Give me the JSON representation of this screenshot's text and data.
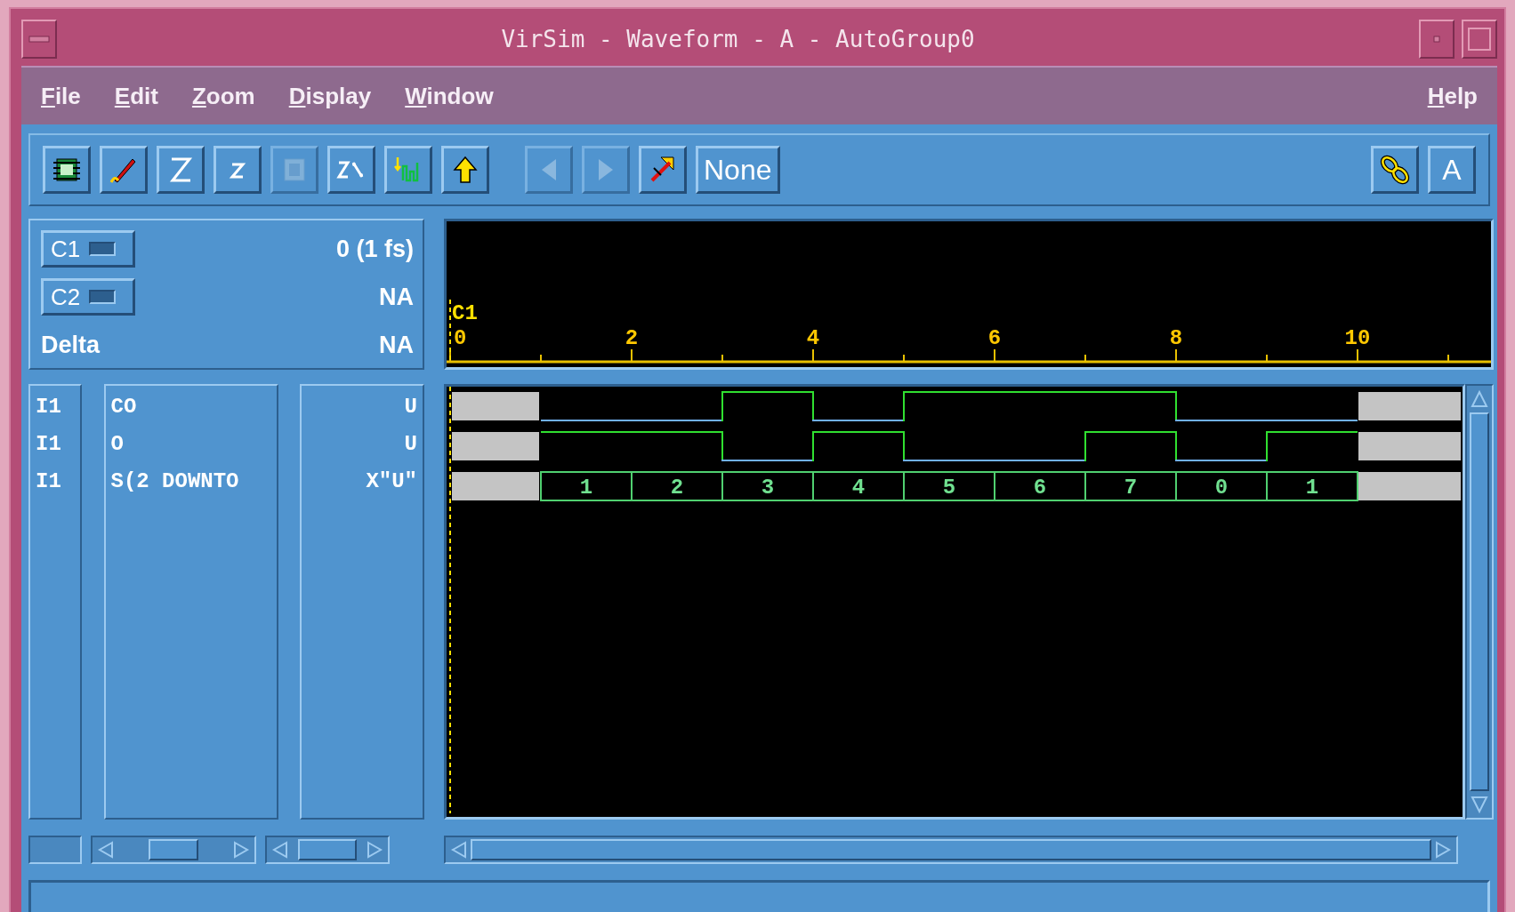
{
  "window": {
    "title": "VirSim - Waveform - A - AutoGroup0"
  },
  "menu": {
    "left": [
      {
        "label": "File"
      },
      {
        "label": "Edit"
      },
      {
        "label": "Zoom"
      },
      {
        "label": "Display"
      },
      {
        "label": "Window"
      }
    ],
    "right": [
      {
        "label": "Help"
      }
    ]
  },
  "toolbar": {
    "buttons": [
      {
        "kind": "icon",
        "disabled": false
      },
      {
        "kind": "icon",
        "disabled": false
      },
      {
        "kind": "icon",
        "disabled": false
      },
      {
        "kind": "icon",
        "disabled": false
      },
      {
        "kind": "icon",
        "disabled": true
      },
      {
        "kind": "icon",
        "disabled": false
      },
      {
        "kind": "icon",
        "disabled": false
      },
      {
        "kind": "icon",
        "disabled": false
      },
      {
        "kind": "icon",
        "disabled": true
      },
      {
        "kind": "icon",
        "disabled": true
      },
      {
        "kind": "icon",
        "disabled": false
      },
      {
        "kind": "text",
        "label": "None",
        "disabled": false
      }
    ],
    "right_buttons": [
      {
        "kind": "icon",
        "disabled": false
      },
      {
        "kind": "text",
        "label": "A",
        "disabled": false
      }
    ]
  },
  "cursors": [
    {
      "label": "C1",
      "value": "0 (1 fs)"
    },
    {
      "label": "C2",
      "value": "NA"
    }
  ],
  "delta": {
    "label": "Delta",
    "value": "NA"
  },
  "ruler": {
    "cursor_label": "C1",
    "labels": [
      "0",
      "2",
      "4",
      "6",
      "8",
      "10"
    ]
  },
  "signals": [
    {
      "group": "I1",
      "name": "CO",
      "value": "U",
      "kind": "bit",
      "high": [
        false,
        false,
        true,
        false,
        true,
        true,
        true,
        false,
        false
      ]
    },
    {
      "group": "I1",
      "name": "O",
      "value": "U",
      "kind": "bit",
      "high": [
        true,
        true,
        false,
        true,
        false,
        false,
        true,
        false,
        true
      ]
    },
    {
      "group": "I1",
      "name": "S(2 DOWNTO",
      "value": "X\"U\"",
      "kind": "bus",
      "values": [
        "1",
        "2",
        "3",
        "4",
        "5",
        "6",
        "7",
        "0",
        "1"
      ]
    }
  ]
}
